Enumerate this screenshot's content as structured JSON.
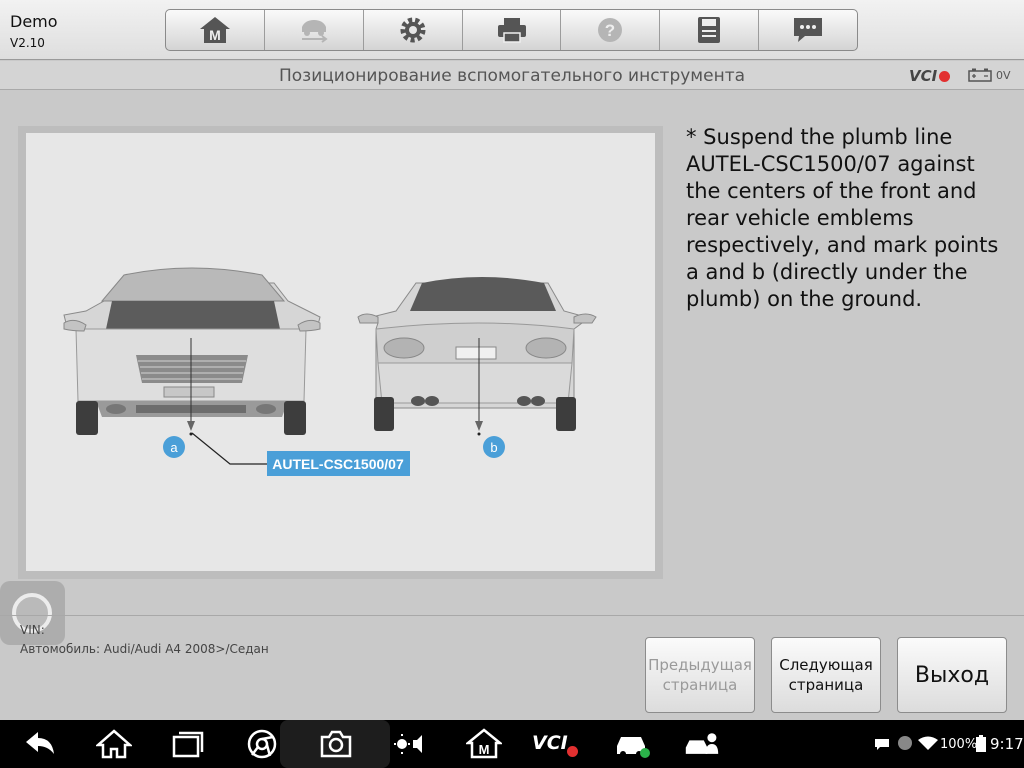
{
  "app": {
    "name": "Demo",
    "version": "V2.10"
  },
  "toolbar": {
    "buttons": [
      {
        "icon": "home-m-icon"
      },
      {
        "icon": "vehicle-swap-icon"
      },
      {
        "icon": "gear-icon"
      },
      {
        "icon": "printer-icon"
      },
      {
        "icon": "help-icon"
      },
      {
        "icon": "save-icon"
      },
      {
        "icon": "message-icon"
      }
    ]
  },
  "header": {
    "title": "Позиционирование вспомогательного инструмента",
    "vci_label": "VCI",
    "voltage": "0V"
  },
  "figure": {
    "point_a": "a",
    "point_b": "b",
    "tool_label": "AUTEL-CSC1500/07",
    "callout_color": "#4a9fd8"
  },
  "instructions": "* Suspend the plumb line AUTEL-CSC1500/07 against the centers of the front and rear vehicle emblems respectively, and mark points a and b (directly under the plumb) on the ground.",
  "footer": {
    "vin_label": "VIN:",
    "vehicle": "Автомобиль: Audi/Audi A4 2008>/Седан",
    "prev_button": "Предыдущая страница",
    "next_button": "Следующая страница",
    "exit_button": "Выход"
  },
  "system_bar": {
    "battery": "100%",
    "time": "9:17",
    "vci_label": "VCI"
  }
}
